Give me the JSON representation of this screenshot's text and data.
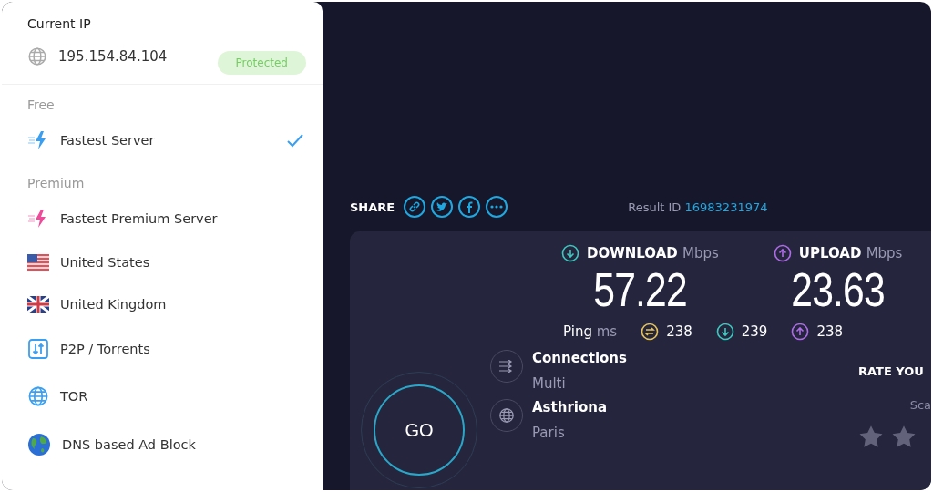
{
  "current_ip": {
    "title": "Current IP",
    "address": "195.154.84.104",
    "status": "Protected"
  },
  "server_menu": [
    {
      "kind": "heading",
      "label": "Free"
    },
    {
      "kind": "server",
      "label": "Fastest Server",
      "selected": true
    },
    {
      "kind": "heading",
      "label": "Premium"
    },
    {
      "kind": "server",
      "label": "Fastest Premium Server",
      "selected": false
    },
    {
      "kind": "server",
      "label": "United States",
      "selected": false
    },
    {
      "kind": "server",
      "label": "United Kingdom",
      "selected": false
    },
    {
      "kind": "server",
      "label": "P2P / Torrents",
      "selected": false
    },
    {
      "kind": "server",
      "label": "TOR",
      "selected": false
    },
    {
      "kind": "server",
      "label": "DNS based Ad Block",
      "selected": false
    }
  ],
  "share": {
    "label": "SHARE"
  },
  "result": {
    "label": "Result ID",
    "id": "16983231974"
  },
  "speeds": [
    {
      "kind": "download",
      "label": "DOWNLOAD",
      "unit": "Mbps",
      "value": "57.22"
    },
    {
      "kind": "upload",
      "label": "UPLOAD",
      "unit": "Mbps",
      "value": "23.63"
    }
  ],
  "ping": {
    "label": "Ping",
    "unit": "ms",
    "readings": [
      {
        "kind": "jitter",
        "value": "238"
      },
      {
        "kind": "download",
        "value": "239"
      },
      {
        "kind": "upload",
        "value": "238"
      }
    ]
  },
  "go_button": "GO",
  "details": [
    {
      "kind": "connections",
      "title": "Connections",
      "value": "Multi"
    },
    {
      "kind": "server",
      "title": "Asthriona",
      "value": "Paris"
    }
  ],
  "rating": {
    "title": "RATE YOU",
    "subtitle": "Sca"
  }
}
